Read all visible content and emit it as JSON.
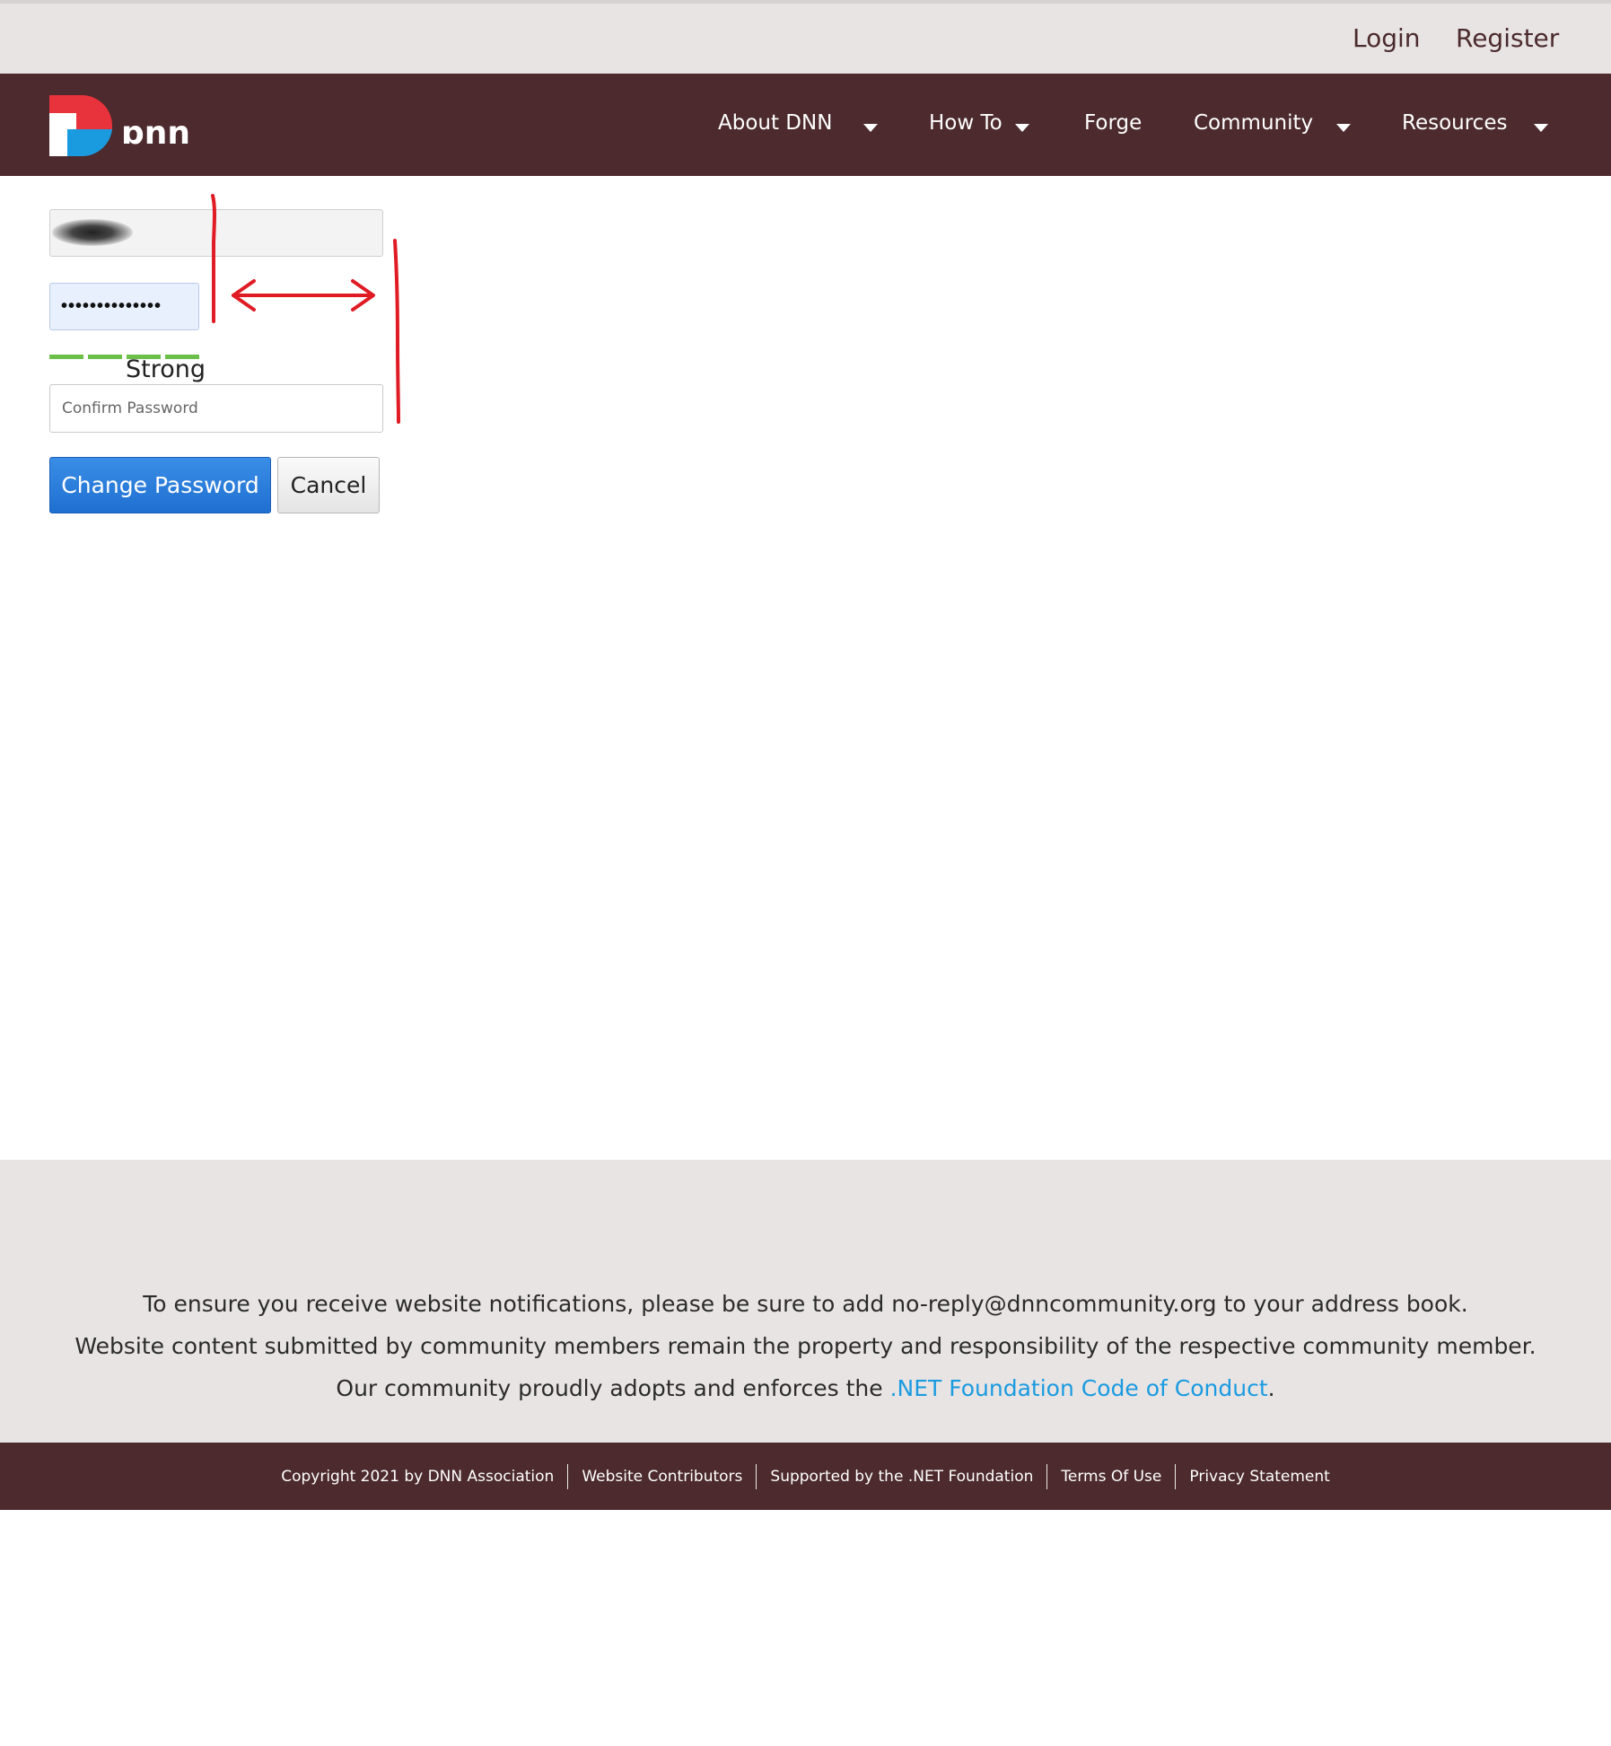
{
  "header": {
    "login_label": "Login",
    "register_label": "Register",
    "logo_text": "DNN",
    "nav": [
      {
        "label": "About DNN",
        "has_dropdown": true
      },
      {
        "label": "How To",
        "has_dropdown": true
      },
      {
        "label": "Forge",
        "has_dropdown": false
      },
      {
        "label": "Community",
        "has_dropdown": true
      },
      {
        "label": "Resources",
        "has_dropdown": true
      }
    ]
  },
  "form": {
    "password_value": "••••••••••••••",
    "strength_label": "Strong",
    "strength_segments": 4,
    "confirm_placeholder": "Confirm Password",
    "change_password_label": "Change Password",
    "cancel_label": "Cancel"
  },
  "footer": {
    "line1": "To ensure you receive website notifications, please be sure to add no-reply@dnncommunity.org to your address book.",
    "line2": "Website content submitted by community members remain the property and responsibility of the respective community member.",
    "line3_prefix": "Our community proudly adopts and enforces the ",
    "line3_link": ".NET Foundation Code of Conduct",
    "line3_suffix": ".",
    "links": [
      "Copyright 2021 by DNN Association",
      "Website Contributors",
      "Supported by the .NET Foundation",
      "Terms Of Use",
      "Privacy Statement"
    ]
  },
  "colors": {
    "brand_maroon": "#4c2a2d",
    "topbar_bg": "#e9e4e4",
    "primary_button": "#1f6fd1",
    "strength_green": "#6cc04a",
    "link_blue": "#1a9be0",
    "annotation_red": "#e01b24"
  }
}
